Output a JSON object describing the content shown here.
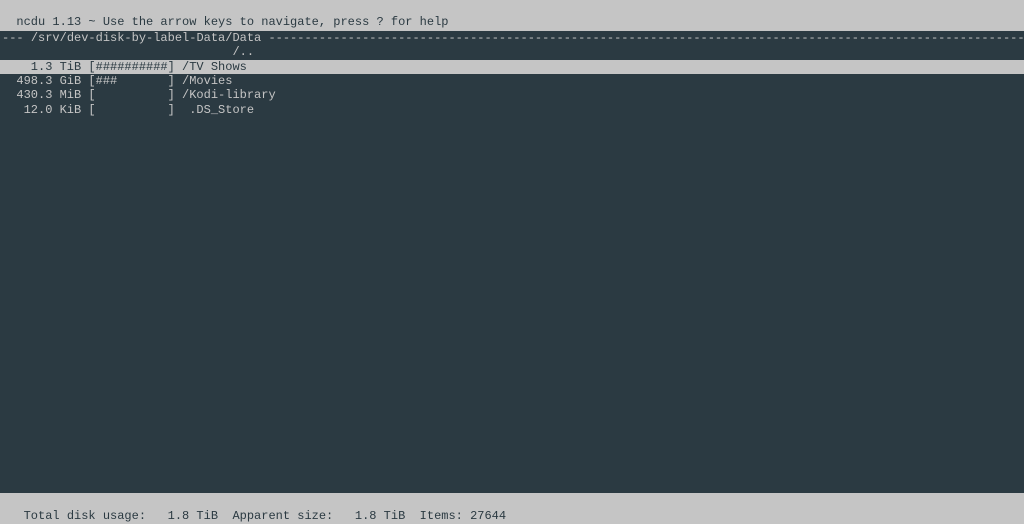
{
  "header": {
    "title_line": "ncdu 1.13 ~ Use the arrow keys to navigate, press ? for help"
  },
  "path": {
    "prefix": "--- ",
    "directory": "/srv/dev-disk-by-label-Data/Data",
    "dashes": " --------------------------------------------------------------------------------------------------------------------------------------"
  },
  "rows": {
    "parent": "                                /..",
    "item0": "    1.3 TiB [##########] /TV Shows",
    "item1": "  498.3 GiB [###       ] /Movies",
    "item2": "  430.3 MiB [          ] /Kodi-library",
    "item3": "   12.0 KiB [          ]  .DS_Store"
  },
  "footer": {
    "line": " Total disk usage:   1.8 TiB  Apparent size:   1.8 TiB  Items: 27644"
  }
}
